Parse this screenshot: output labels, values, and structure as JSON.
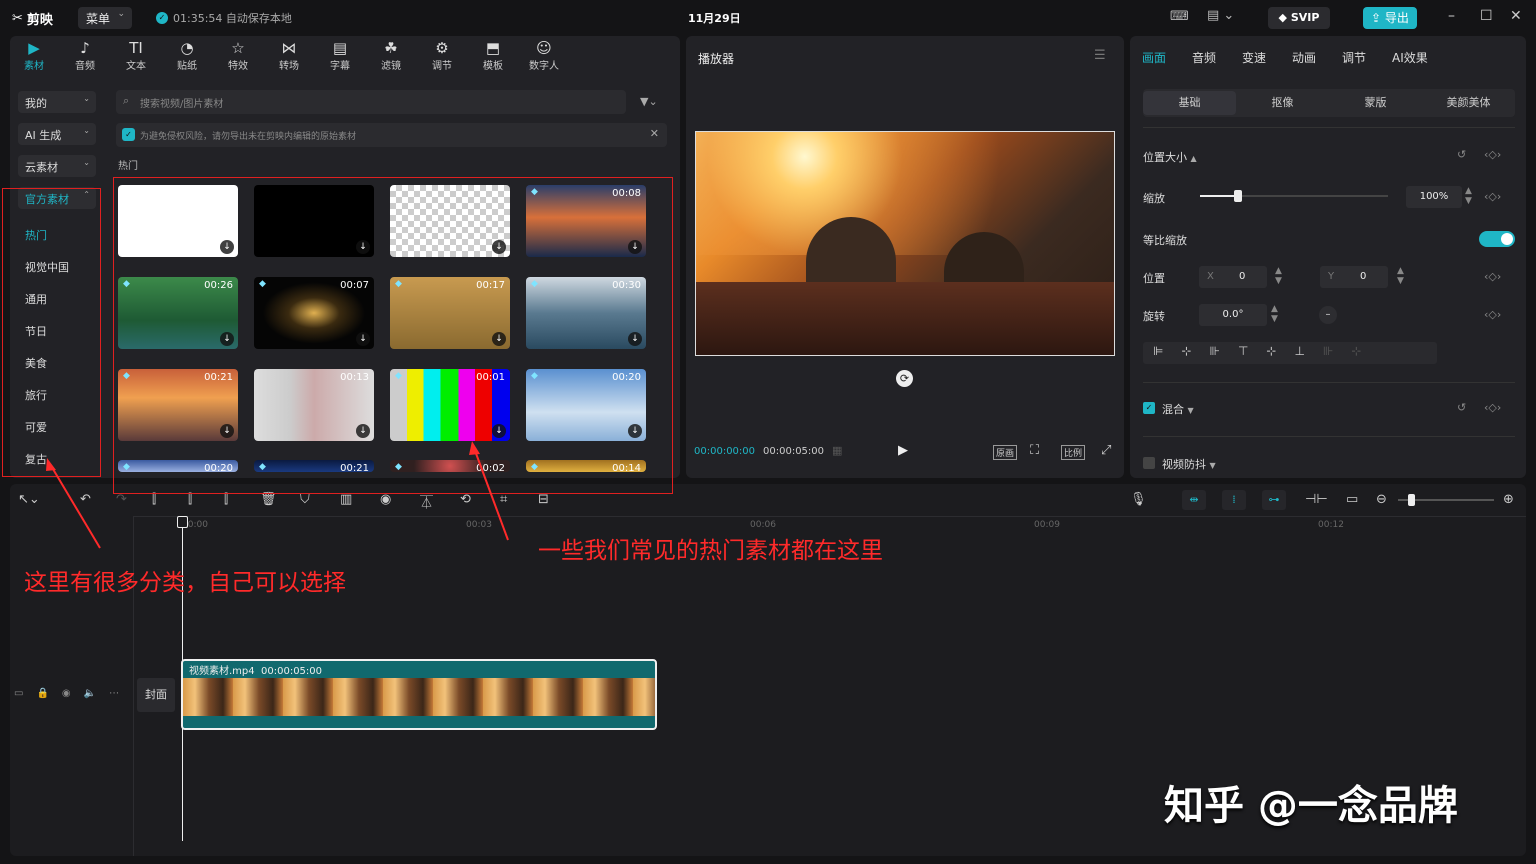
{
  "titlebar": {
    "app_name": "剪映",
    "menu_label": "菜单",
    "autosave": "01:35:54 自动保存本地",
    "project_title": "11月29日",
    "svip_label": "SVIP",
    "export_label": "导出"
  },
  "toolbar": [
    {
      "label": "素材",
      "icon": "media-icon"
    },
    {
      "label": "音频",
      "icon": "audio-icon"
    },
    {
      "label": "文本",
      "icon": "text-icon"
    },
    {
      "label": "贴纸",
      "icon": "sticker-icon"
    },
    {
      "label": "特效",
      "icon": "effects-icon"
    },
    {
      "label": "转场",
      "icon": "transition-icon"
    },
    {
      "label": "字幕",
      "icon": "subtitle-icon"
    },
    {
      "label": "滤镜",
      "icon": "filter-icon"
    },
    {
      "label": "调节",
      "icon": "adjust-icon"
    },
    {
      "label": "模板",
      "icon": "template-icon"
    },
    {
      "label": "数字人",
      "icon": "avatar-icon"
    }
  ],
  "sidebar": {
    "dropdowns": [
      "我的",
      "AI 生成",
      "云素材",
      "官方素材"
    ],
    "items": [
      "热门",
      "视觉中国",
      "通用",
      "节日",
      "美食",
      "旅行",
      "可爱",
      "复古"
    ]
  },
  "library": {
    "search_placeholder": "搜索视频/图片素材",
    "notice": "为避免侵权风险，请勿导出未在剪映内编辑的原始素材",
    "section": "热门",
    "items": [
      {
        "duration": ""
      },
      {
        "duration": ""
      },
      {
        "duration": ""
      },
      {
        "duration": "00:08"
      },
      {
        "duration": "00:26"
      },
      {
        "duration": "00:07"
      },
      {
        "duration": "00:17"
      },
      {
        "duration": "00:30"
      },
      {
        "duration": "00:21"
      },
      {
        "duration": "00:13"
      },
      {
        "duration": "00:01"
      },
      {
        "duration": "00:20"
      },
      {
        "duration": "00:20"
      },
      {
        "duration": "00:21"
      },
      {
        "duration": "00:02"
      },
      {
        "duration": "00:14"
      }
    ]
  },
  "player": {
    "title": "播放器",
    "time_current": "00:00:00:00",
    "time_total": "00:00:05:00",
    "btn_original": "原画",
    "btn_ratio": "比例"
  },
  "inspector": {
    "tabs": [
      "画面",
      "音频",
      "变速",
      "动画",
      "调节",
      "AI效果"
    ],
    "subtabs": [
      "基础",
      "抠像",
      "蒙版",
      "美颜美体"
    ],
    "section_position": "位置大小",
    "scale_label": "缩放",
    "scale_value": "100%",
    "scale_fraction": 0.2,
    "uniform_label": "等比缩放",
    "position_label": "位置",
    "pos_x_label": "X",
    "pos_x": "0",
    "pos_y_label": "Y",
    "pos_y": "0",
    "rotate_label": "旋转",
    "rotate_value": "0.0°",
    "blend_label": "混合",
    "stabilize_label": "视频防抖"
  },
  "timeline": {
    "ruler": [
      "00:00",
      "00:03",
      "00:06",
      "00:09",
      "00:12"
    ],
    "cover_label": "封面",
    "clip_name": "视频素材.mp4",
    "clip_duration": "00:00:05:00"
  },
  "annotations": {
    "left": "这里有很多分类，自己可以选择",
    "middle": "一些我们常见的热门素材都在这里",
    "watermark": "知乎 @一念品牌"
  },
  "colors": {
    "accent": "#1fb6c6",
    "annotation": "#ff2a2a"
  }
}
